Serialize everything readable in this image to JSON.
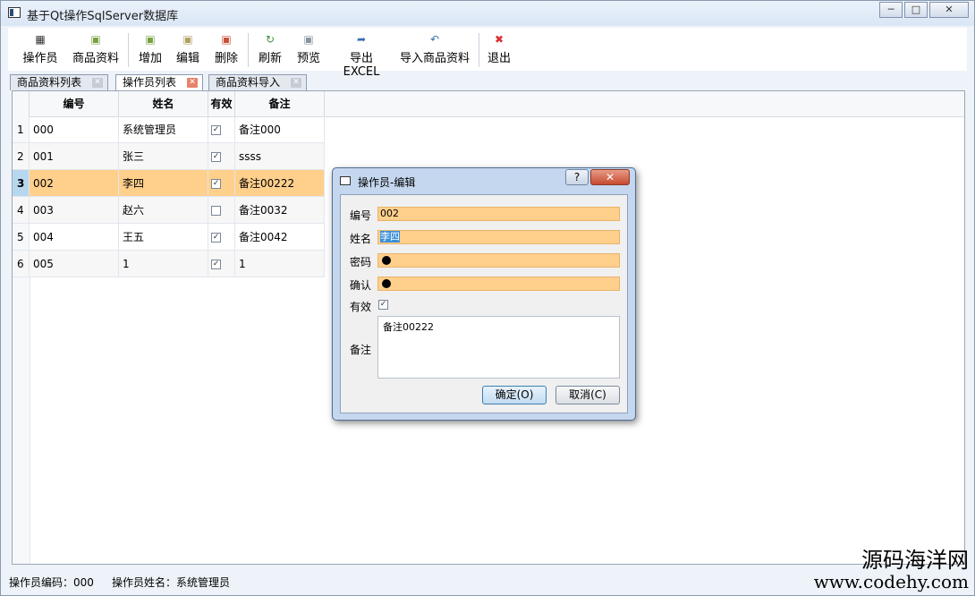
{
  "window": {
    "title": "基于Qt操作SqlServer数据库"
  },
  "toolbar": {
    "items": [
      {
        "label": "操作员",
        "icon": "operator-icon"
      },
      {
        "label": "商品资料",
        "icon": "product-icon"
      },
      {
        "label": "增加",
        "icon": "add-icon"
      },
      {
        "label": "编辑",
        "icon": "edit-icon"
      },
      {
        "label": "删除",
        "icon": "delete-icon"
      },
      {
        "label": "刷新",
        "icon": "refresh-icon"
      },
      {
        "label": "预览",
        "icon": "preview-icon"
      },
      {
        "label": "导出EXCEL",
        "icon": "export-icon"
      },
      {
        "label": "导入商品资料",
        "icon": "import-icon"
      },
      {
        "label": "退出",
        "icon": "exit-icon"
      }
    ]
  },
  "tabs": [
    {
      "label": "商品资料列表",
      "active": false
    },
    {
      "label": "操作员列表",
      "active": true
    },
    {
      "label": "商品资料导入",
      "active": false
    }
  ],
  "table": {
    "columns": [
      "编号",
      "姓名",
      "有效",
      "备注"
    ],
    "rows": [
      {
        "n": "1",
        "id": "000",
        "name": "系统管理员",
        "valid": true,
        "note": "备注000"
      },
      {
        "n": "2",
        "id": "001",
        "name": "张三",
        "valid": true,
        "note": "ssss"
      },
      {
        "n": "3",
        "id": "002",
        "name": "李四",
        "valid": true,
        "note": "备注00222",
        "selected": true
      },
      {
        "n": "4",
        "id": "003",
        "name": "赵六",
        "valid": false,
        "note": "备注0032"
      },
      {
        "n": "5",
        "id": "004",
        "name": "王五",
        "valid": true,
        "note": "备注0042"
      },
      {
        "n": "6",
        "id": "005",
        "name": "1",
        "valid": true,
        "note": "1"
      }
    ]
  },
  "status": {
    "code_label": "操作员编码：000",
    "name_label": "操作员姓名：系统管理员"
  },
  "watermark": {
    "line1": "源码海洋网",
    "line2": "www.codehy.com"
  },
  "dialog": {
    "title": "操作员-编辑",
    "help": "?",
    "labels": {
      "id": "编号",
      "name": "姓名",
      "password": "密码",
      "confirm": "确认",
      "valid": "有效",
      "note": "备注"
    },
    "values": {
      "id": "002",
      "name": "李四",
      "note": "备注00222",
      "valid": true
    },
    "ok": "确定(O)",
    "cancel": "取消(C)"
  },
  "colors": {
    "selection": "#ffcf8c",
    "rownum_selected": "#b7d7ef"
  }
}
